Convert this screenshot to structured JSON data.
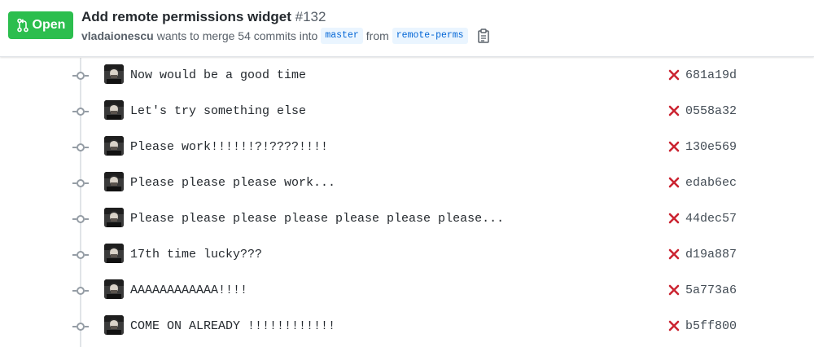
{
  "pull_request": {
    "state": "Open",
    "title": "Add remote permissions widget",
    "number": "#132",
    "author": "vladaionescu",
    "merge_text": "wants to merge 54 commits into",
    "base_branch": "master",
    "from_text": "from",
    "head_branch": "remote-perms"
  },
  "colors": {
    "open_green": "#2cbe4e",
    "failure_red": "#cb2431",
    "branch_blue": "#0366d6"
  },
  "commits": [
    {
      "message": "Now would be a good time",
      "status": "failure",
      "sha": "681a19d"
    },
    {
      "message": "Let's try something else",
      "status": "failure",
      "sha": "0558a32"
    },
    {
      "message": "Please work!!!!!!?!????!!!!",
      "status": "failure",
      "sha": "130e569"
    },
    {
      "message": "Please please please work...",
      "status": "failure",
      "sha": "edab6ec"
    },
    {
      "message": "Please please please please please please please...",
      "status": "failure",
      "sha": "44dec57"
    },
    {
      "message": "17th time lucky???",
      "status": "failure",
      "sha": "d19a887"
    },
    {
      "message": "AAAAAAAAAAAA!!!!",
      "status": "failure",
      "sha": "5a773a6"
    },
    {
      "message": "COME ON ALREADY !!!!!!!!!!!!",
      "status": "failure",
      "sha": "b5ff800"
    }
  ]
}
